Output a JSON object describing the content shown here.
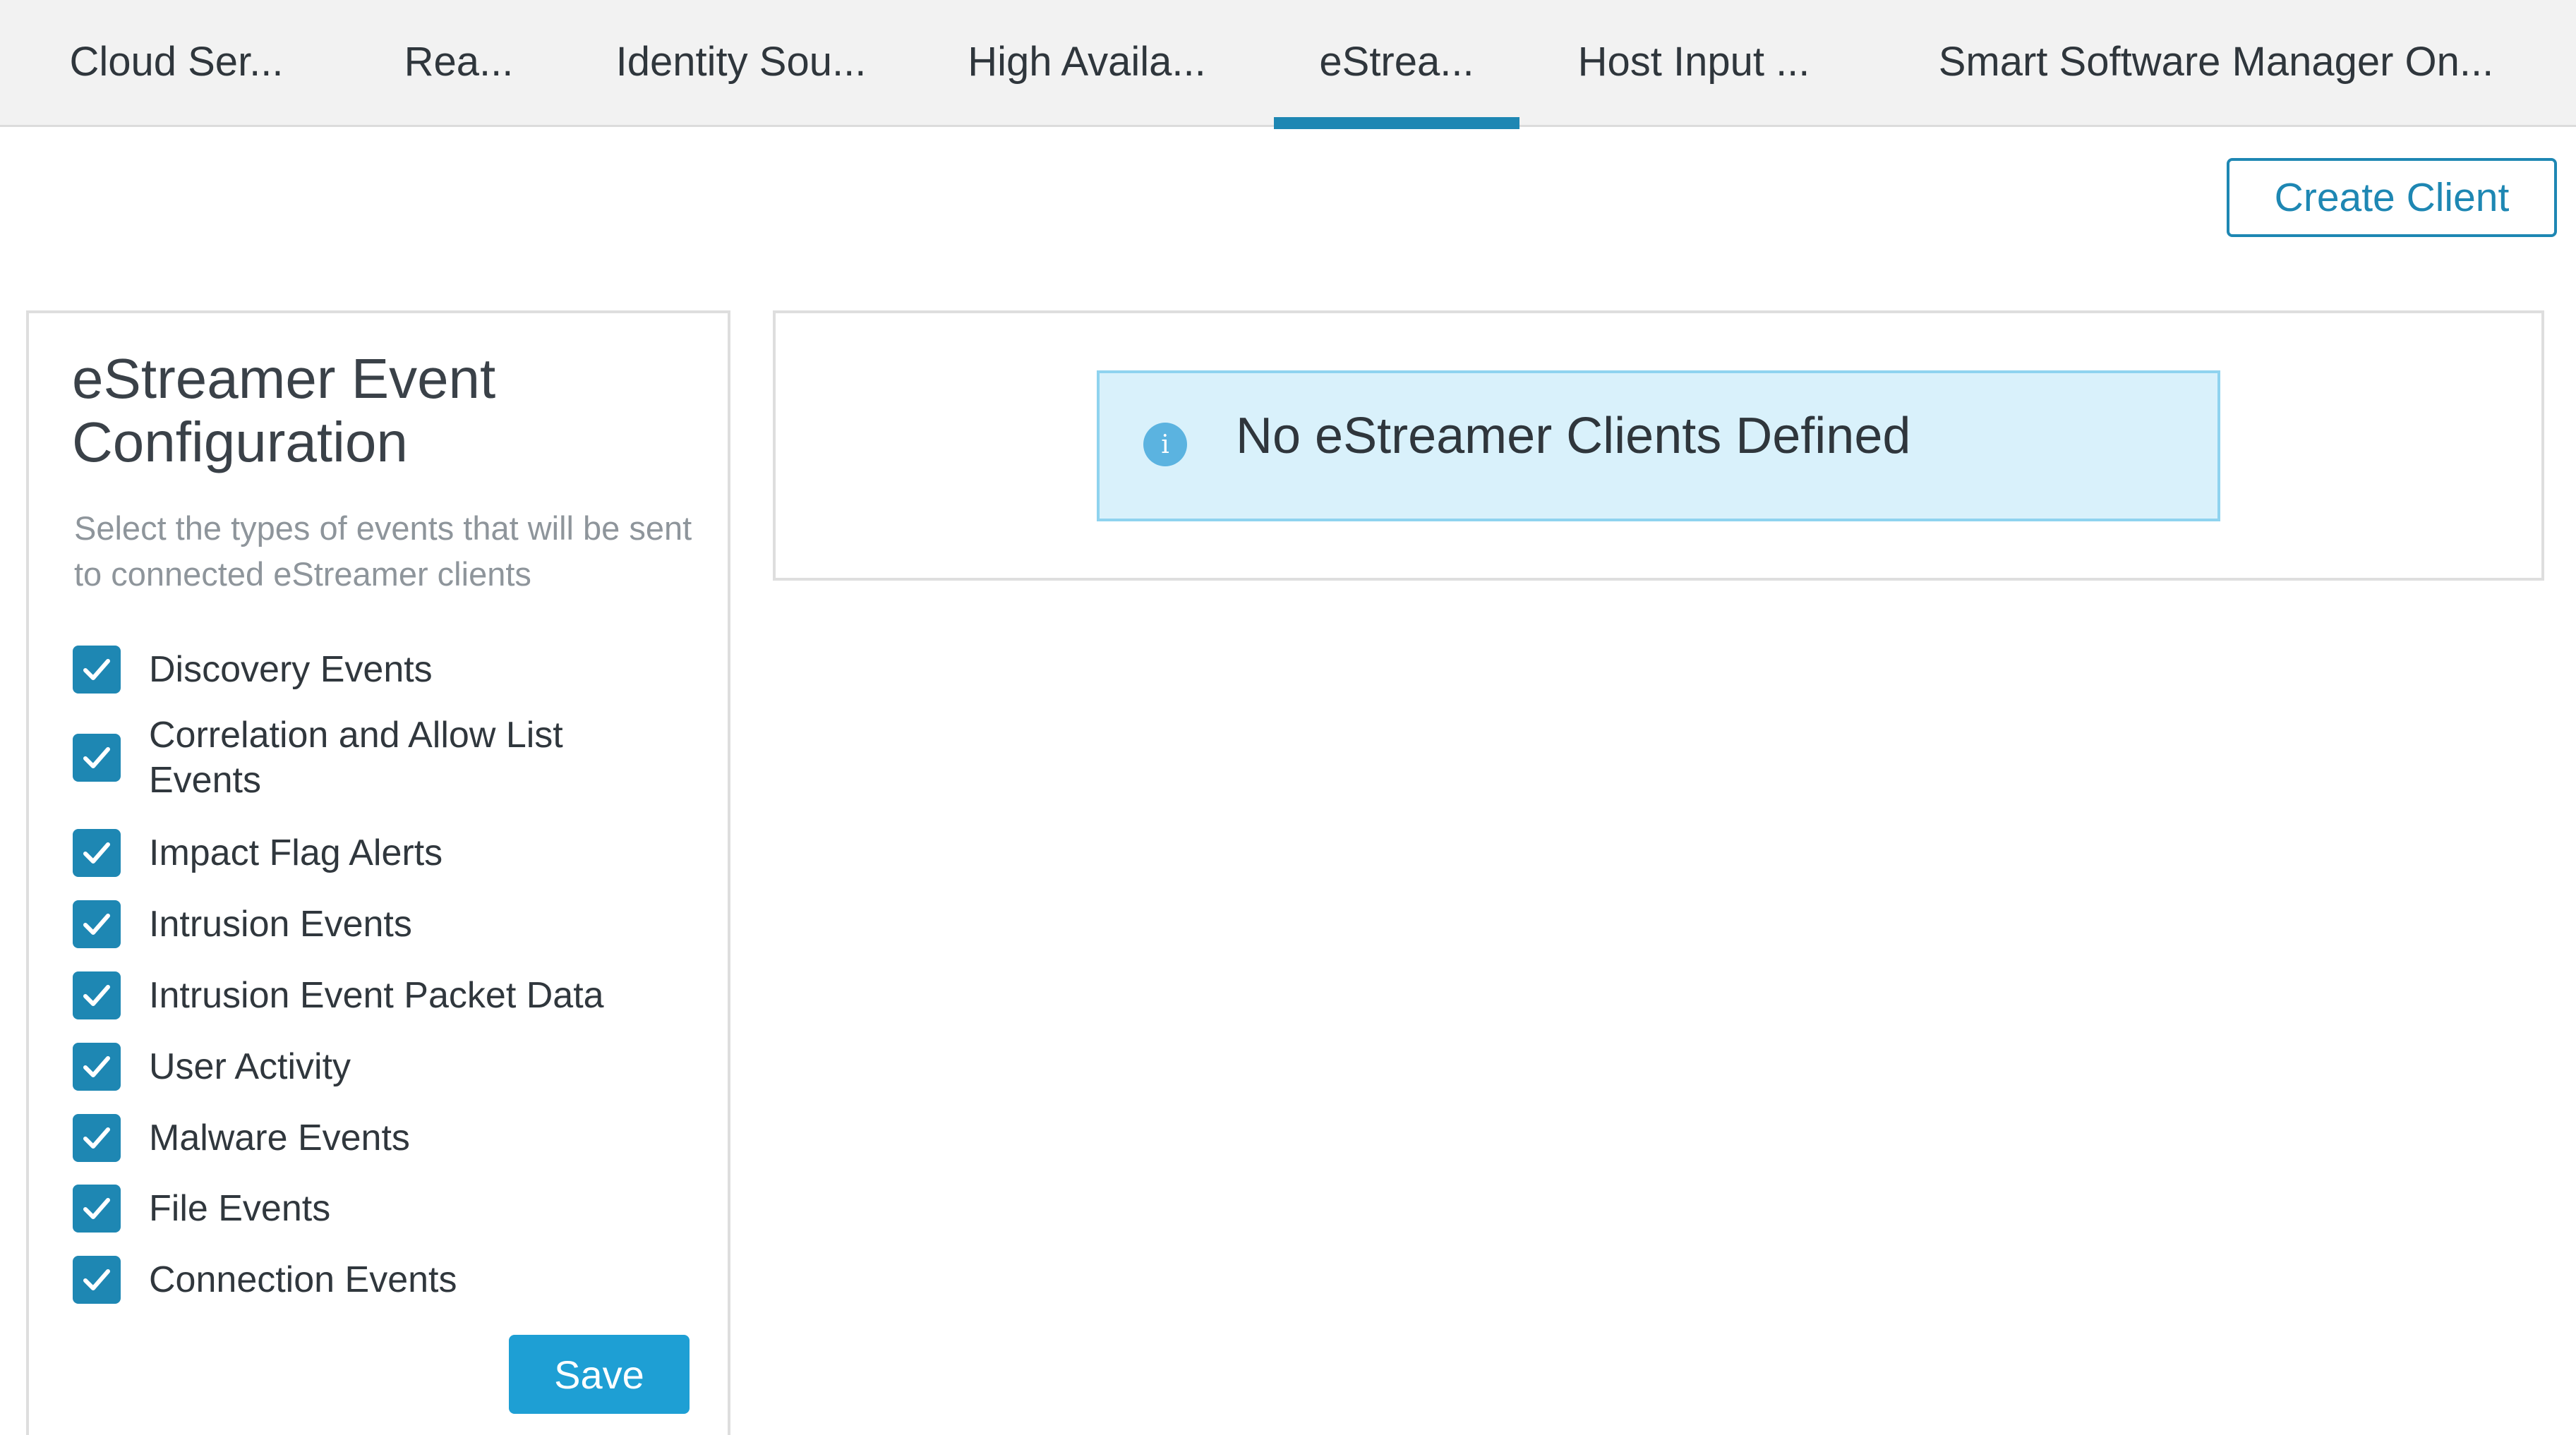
{
  "tabs": [
    {
      "label": "Cloud Ser...",
      "active": false
    },
    {
      "label": "Rea...",
      "active": false
    },
    {
      "label": "Identity Sou...",
      "active": false
    },
    {
      "label": "High Availa...",
      "active": false
    },
    {
      "label": "eStrea...",
      "active": true
    },
    {
      "label": "Host Input ...",
      "active": false
    },
    {
      "label": "Smart Software Manager On...",
      "active": false
    }
  ],
  "toolbar": {
    "create_client_label": "Create Client"
  },
  "config": {
    "title": "eStreamer Event Configuration",
    "description": "Select the types of events that will be sent to connected eStreamer clients",
    "events": [
      {
        "label": "Discovery Events",
        "checked": true
      },
      {
        "label": "Correlation and Allow List Events",
        "checked": true
      },
      {
        "label": "Impact Flag Alerts",
        "checked": true
      },
      {
        "label": "Intrusion Events",
        "checked": true
      },
      {
        "label": "Intrusion Event Packet Data",
        "checked": true
      },
      {
        "label": "User Activity",
        "checked": true
      },
      {
        "label": "Malware Events",
        "checked": true
      },
      {
        "label": "File Events",
        "checked": true
      },
      {
        "label": "Connection Events",
        "checked": true
      }
    ],
    "save_label": "Save"
  },
  "clients": {
    "empty_message": "No eStreamer Clients Defined",
    "info_icon_glyph": "i"
  },
  "colors": {
    "accent": "#1e87b3",
    "save_button": "#1e9fd4",
    "info_background": "#d9f1fb",
    "info_border": "#8fd3ef"
  },
  "icons": {
    "checkbox": "checkmark-icon",
    "info": "info-icon"
  }
}
